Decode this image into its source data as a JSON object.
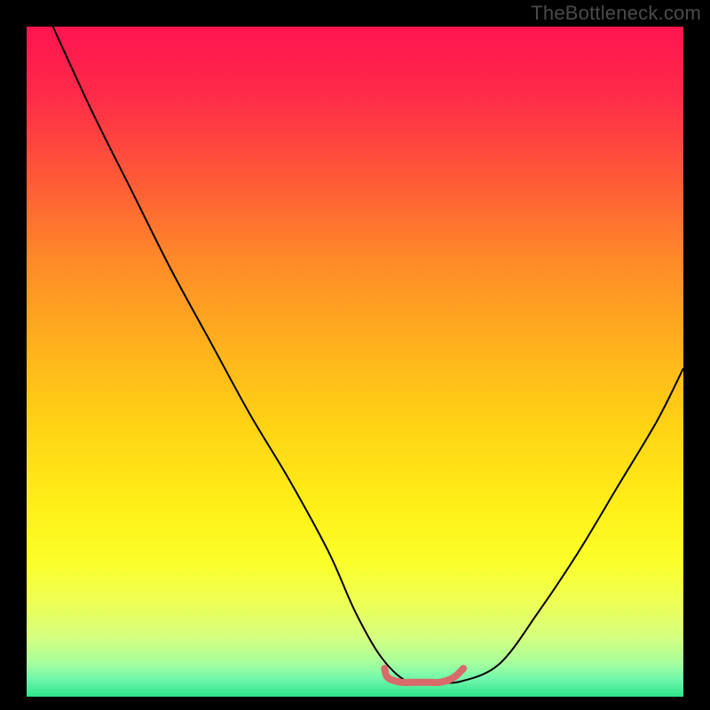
{
  "watermark": "TheBottleneck.com",
  "chart_data": {
    "type": "line",
    "title": "",
    "xlabel": "",
    "ylabel": "",
    "xlim": [
      0,
      100
    ],
    "ylim": [
      -2,
      100
    ],
    "grid": false,
    "legend": false,
    "series": [
      {
        "name": "bottleneck-curve",
        "stroke": "#000000",
        "stroke_width": 2,
        "x": [
          4,
          10,
          16,
          22,
          28,
          34,
          40,
          46,
          50,
          54,
          58,
          62,
          66,
          72,
          78,
          84,
          90,
          96,
          100
        ],
        "y": [
          100,
          87,
          75,
          63,
          52,
          41,
          31,
          20,
          11,
          4,
          0.3,
          0.3,
          0.3,
          3,
          11,
          20,
          30,
          40,
          48
        ]
      },
      {
        "name": "optimal-band",
        "stroke": "#d86a6a",
        "stroke_width": 8,
        "linecap": "round",
        "x": [
          54.5,
          55,
          57,
          59,
          61,
          63,
          65,
          66.5
        ],
        "y": [
          2.3,
          0.9,
          0.2,
          0.2,
          0.2,
          0.2,
          0.9,
          2.3
        ]
      }
    ],
    "background_gradient": {
      "stops": [
        {
          "offset": 0.0,
          "color": "#ff1450"
        },
        {
          "offset": 0.1,
          "color": "#ff2a49"
        },
        {
          "offset": 0.22,
          "color": "#ff5738"
        },
        {
          "offset": 0.35,
          "color": "#ff8a28"
        },
        {
          "offset": 0.48,
          "color": "#ffb21c"
        },
        {
          "offset": 0.6,
          "color": "#ffd414"
        },
        {
          "offset": 0.72,
          "color": "#fff018"
        },
        {
          "offset": 0.8,
          "color": "#fbff2a"
        },
        {
          "offset": 0.86,
          "color": "#edff55"
        },
        {
          "offset": 0.91,
          "color": "#d6ff7e"
        },
        {
          "offset": 0.95,
          "color": "#a6ff9d"
        },
        {
          "offset": 0.975,
          "color": "#6cf7ab"
        },
        {
          "offset": 1.0,
          "color": "#2fe38b"
        }
      ]
    }
  }
}
